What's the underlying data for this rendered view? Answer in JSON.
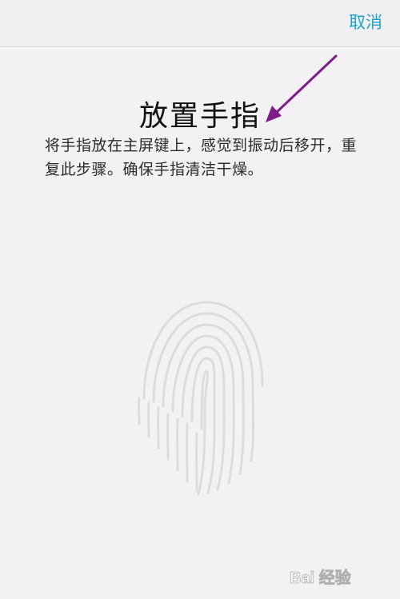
{
  "header": {
    "cancel_label": "取消"
  },
  "main": {
    "title": "放置手指",
    "instructions": "将手指放在主屏键上，感觉到振动后移开，重复此步骤。确保手指清洁干燥。"
  },
  "icons": {
    "fingerprint": "fingerprint-icon",
    "annotation": "arrow-icon",
    "watermark": "baidu-logo"
  },
  "colors": {
    "background": "#f3f1f3",
    "accent": "#1aa3cf",
    "annotation": "#7e1c8c",
    "fingerprint_lines": "#dddbdd"
  },
  "watermark": {
    "text": "Bai 经验"
  }
}
